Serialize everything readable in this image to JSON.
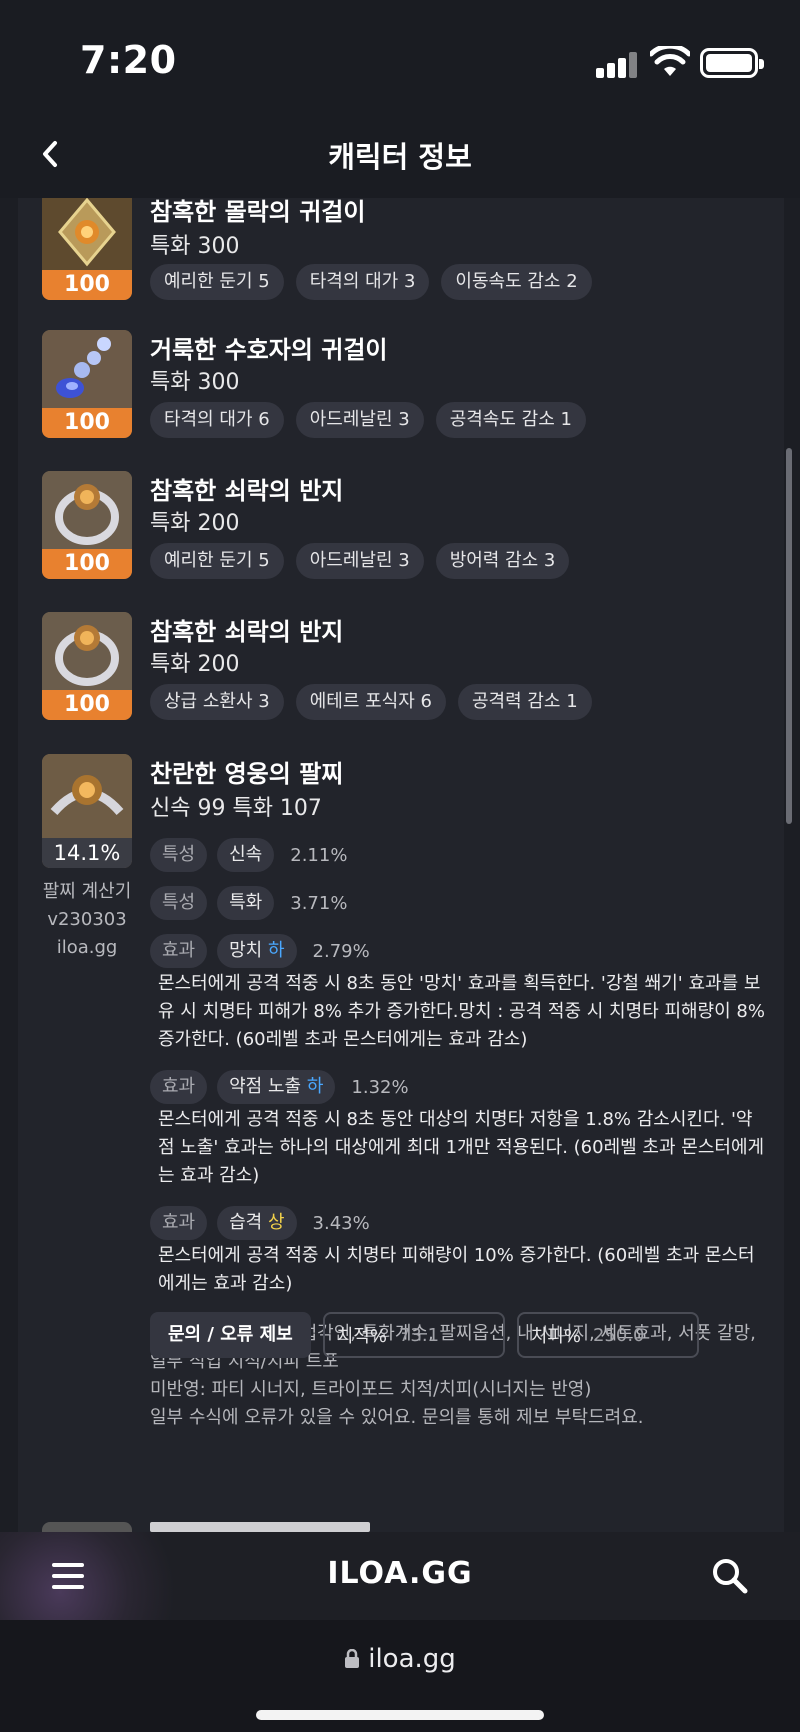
{
  "status": {
    "time": "7:20"
  },
  "nav": {
    "title": "캐릭터 정보"
  },
  "items": [
    {
      "name": "참혹한 몰락의 귀걸이",
      "stat": "특화 300",
      "quality": "100",
      "tags": [
        "예리한 둔기 5",
        "타격의 대가 3",
        "이동속도 감소 2"
      ]
    },
    {
      "name": "거룩한 수호자의 귀걸이",
      "stat": "특화 300",
      "quality": "100",
      "tags": [
        "타격의 대가 6",
        "아드레날린 3",
        "공격속도 감소 1"
      ]
    },
    {
      "name": "참혹한 쇠락의 반지",
      "stat": "특화 200",
      "quality": "100",
      "tags": [
        "예리한 둔기 5",
        "아드레날린 3",
        "방어력 감소 3"
      ]
    },
    {
      "name": "참혹한 쇠락의 반지",
      "stat": "특화 200",
      "quality": "100",
      "tags": [
        "상급 소환사 3",
        "에테르 포식자 6",
        "공격력 감소 1"
      ]
    }
  ],
  "bracelet": {
    "name": "찬란한 영웅의 팔찌",
    "stat": "신속 99  특화 107",
    "percent": "14.1%",
    "calc_lines": [
      "팔찌 계산기",
      "v230303",
      "iloa.gg"
    ],
    "options": [
      {
        "type": "특성",
        "name": "신속",
        "grade": "",
        "value": "2.11%"
      },
      {
        "type": "특성",
        "name": "특화",
        "grade": "",
        "value": "3.71%"
      },
      {
        "type": "효과",
        "name": "망치",
        "grade": "하",
        "value": "2.79%",
        "desc": "몬스터에게 공격 적중 시 8초 동안 '망치' 효과를 획득한다. '강철 쐐기' 효과를 보유 시 치명타 피해가 8% 추가 증가한다.망치 : 공격 적중 시 치명타 피해량이 8% 증가한다. (60레벨 초과 몬스터에게는 효과 감소)"
      },
      {
        "type": "효과",
        "name": "약점 노출",
        "grade": "하",
        "value": "1.32%",
        "desc": "몬스터에게 공격 적중 시 8초 동안 대상의 치명타 저항을 1.8% 감소시킨다. '약점 노출' 효과는 하나의 대상에게 최대 1개만 적용된다. (60레벨 초과 몬스터에게는 효과 감소)"
      },
      {
        "type": "효과",
        "name": "습격",
        "grade": "상",
        "value": "3.43%",
        "desc": "몬스터에게 공격 적중 시 치명타 피해량이 10% 증가한다. (60레벨 초과 몬스터에게는 효과 감소)"
      }
    ],
    "note_reflected": "반영: 스탯, 각인, 직업각인, 특화계수, 팔찌옵션, 내 시너지, 세트효과, 서폿 갈망, 일부 직업 치적/치피 트포",
    "note_unreflected": "미반영: 파티 시너지, 트라이포드 치적/치피(시너지는 반영)",
    "note_error": "일부 수식에 오류가 있을 수 있어요. 문의를 통해 제보 부탁드려요.",
    "report_label": "문의 / 오류 제보",
    "crit_rate_label": "치적%",
    "crit_rate_value": "73.1",
    "crit_dmg_label": "치피%",
    "crit_dmg_value": "250.0"
  },
  "bottom_nav": {
    "logo": "ILOA.GG"
  },
  "browser": {
    "url": "iloa.gg"
  },
  "colors": {
    "quality": "#e8812f",
    "grade_low": "#4aa8ff",
    "grade_high": "#f2d14a",
    "background": "#22242b"
  },
  "icons": [
    "back-chevron-icon",
    "signal-icon",
    "wifi-icon",
    "battery-icon",
    "menu-icon",
    "search-icon",
    "lock-icon"
  ]
}
